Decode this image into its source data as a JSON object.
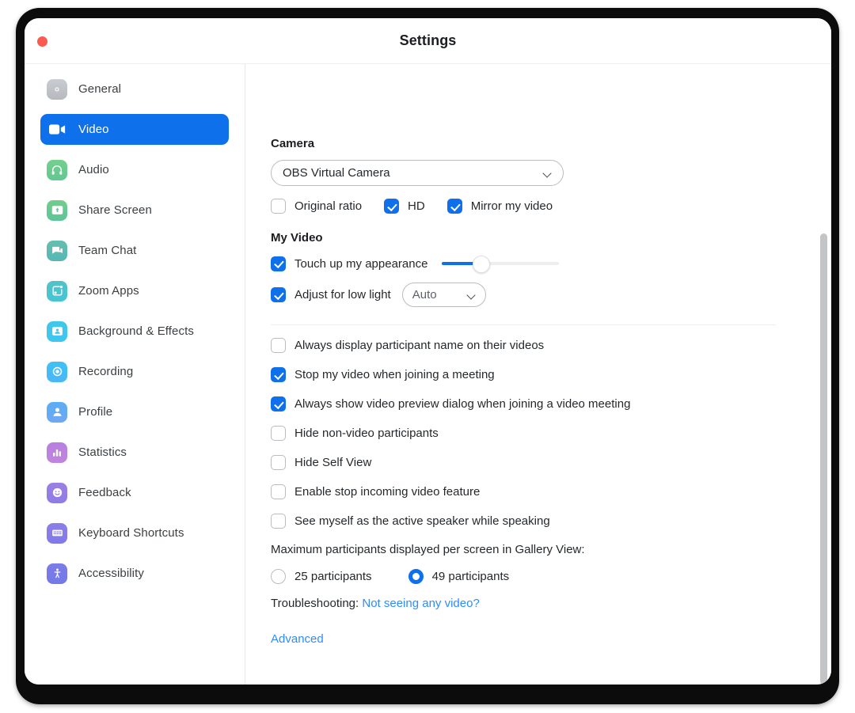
{
  "window": {
    "title": "Settings",
    "close_button": "close-traffic-light"
  },
  "sidebar": {
    "items": [
      {
        "label": "General",
        "icon": "gear-icon",
        "color_start": "#c9ccd0",
        "color_end": "#b6babf",
        "active": false
      },
      {
        "label": "Video",
        "icon": "video-camera-icon",
        "color_start": "#0e71eb",
        "color_end": "#0e71eb",
        "active": true
      },
      {
        "label": "Audio",
        "icon": "headphones-icon",
        "color_start": "#73d08d",
        "color_end": "#63c792",
        "active": false
      },
      {
        "label": "Share Screen",
        "icon": "share-screen-icon",
        "color_start": "#6fcf8a",
        "color_end": "#5ec49a",
        "active": false
      },
      {
        "label": "Team Chat",
        "icon": "chat-bubble-icon",
        "color_start": "#63bfae",
        "color_end": "#58b7b5",
        "active": false
      },
      {
        "label": "Zoom Apps",
        "icon": "zoom-apps-icon",
        "color_start": "#4fc3c8",
        "color_end": "#46c4d4",
        "active": false
      },
      {
        "label": "Background & Effects",
        "icon": "person-frame-icon",
        "color_start": "#40c8e8",
        "color_end": "#3ec6f0",
        "active": false
      },
      {
        "label": "Recording",
        "icon": "record-circle-icon",
        "color_start": "#3ec2f5",
        "color_end": "#4ab6f7",
        "active": false
      },
      {
        "label": "Profile",
        "icon": "person-icon",
        "color_start": "#5aaef5",
        "color_end": "#6fa8f2",
        "active": false
      },
      {
        "label": "Statistics",
        "icon": "bar-chart-icon",
        "color_start": "#b77fe0",
        "color_end": "#c185dd",
        "active": false
      },
      {
        "label": "Feedback",
        "icon": "smiley-face-icon",
        "color_start": "#9b7fe3",
        "color_end": "#8f7ce6",
        "active": false
      },
      {
        "label": "Keyboard Shortcuts",
        "icon": "keyboard-icon",
        "color_start": "#8d7ee8",
        "color_end": "#8179e9",
        "active": false
      },
      {
        "label": "Accessibility",
        "icon": "accessibility-icon",
        "color_start": "#7b7ce8",
        "color_end": "#7479e6",
        "active": false
      }
    ]
  },
  "main": {
    "camera": {
      "heading": "Camera",
      "selected_device": "OBS Virtual Camera",
      "dropdown_icon": "chevron-down-icon",
      "options": [
        {
          "label": "Original ratio",
          "checked": false
        },
        {
          "label": "HD",
          "checked": true
        },
        {
          "label": "Mirror my video",
          "checked": true
        }
      ]
    },
    "my_video": {
      "heading": "My Video",
      "touch_up": {
        "label": "Touch up my appearance",
        "checked": true,
        "slider_percent": 33
      },
      "low_light": {
        "label": "Adjust for low light",
        "checked": true,
        "mode": "Auto",
        "dropdown_icon": "chevron-down-icon"
      }
    },
    "checkboxes": [
      {
        "label": "Always display participant name on their videos",
        "checked": false
      },
      {
        "label": "Stop my video when joining a meeting",
        "checked": true
      },
      {
        "label": "Always show video preview dialog when joining a video meeting",
        "checked": true
      },
      {
        "label": "Hide non-video participants",
        "checked": false
      },
      {
        "label": "Hide Self View",
        "checked": false
      },
      {
        "label": "Enable stop incoming video feature",
        "checked": false
      },
      {
        "label": "See myself as the active speaker while speaking",
        "checked": false
      }
    ],
    "gallery": {
      "label": "Maximum participants displayed per screen in Gallery View:",
      "options": [
        {
          "label": "25 participants",
          "selected": false
        },
        {
          "label": "49 participants",
          "selected": true
        }
      ]
    },
    "troubleshooting": {
      "prefix": "Troubleshooting:",
      "link": "Not seeing any video?"
    },
    "advanced_link": "Advanced"
  },
  "colors": {
    "accent": "#0e71eb",
    "link": "#2d8cff",
    "close": "#fb5a50",
    "text": "#25282b"
  }
}
